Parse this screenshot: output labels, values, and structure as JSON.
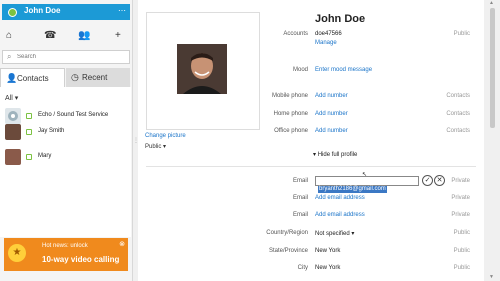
{
  "user": {
    "name": "John Doe"
  },
  "search": {
    "placeholder": "Search"
  },
  "tabs": [
    {
      "label": "Contacts"
    },
    {
      "label": "Recent"
    }
  ],
  "list_filter": "All",
  "contacts": [
    {
      "name": "Echo / Sound Test Service"
    },
    {
      "name": "Jay Smith"
    },
    {
      "name": "Mary"
    }
  ],
  "promo": {
    "line1": "Hot news: unlock",
    "line2": "10-way video calling"
  },
  "profile": {
    "display_name": "John Doe",
    "change_picture": "Change picture",
    "picture_visibility": "Public",
    "hide_full_profile": "Hide full profile",
    "fields": [
      {
        "label": "Accounts",
        "value": "doe47566",
        "sub": "Manage",
        "visibility": "Public"
      },
      {
        "label": "Mood",
        "value": "Enter mood message",
        "visibility": ""
      },
      {
        "label": "Mobile phone",
        "value": "Add number",
        "visibility": "Contacts"
      },
      {
        "label": "Home phone",
        "value": "Add number",
        "visibility": "Contacts"
      },
      {
        "label": "Office phone",
        "value": "Add number",
        "visibility": "Contacts"
      },
      {
        "label": "Email",
        "value": "bryanth2186@gmail.com",
        "visibility": "Private"
      },
      {
        "label": "Email",
        "value": "Add email address",
        "visibility": "Private"
      },
      {
        "label": "Email",
        "value": "Add email address",
        "visibility": "Private"
      },
      {
        "label": "Country/Region",
        "value": "Not specified",
        "visibility": "Public"
      },
      {
        "label": "State/Province",
        "value": "New York",
        "visibility": "Public"
      },
      {
        "label": "City",
        "value": "New York",
        "visibility": "Public"
      }
    ]
  },
  "colors": {
    "accent": "#1c9ad6",
    "link": "#1a74c9",
    "promo": "#f08a1d",
    "online": "#7cc242"
  },
  "icons": [
    "home-icon",
    "dial-icon",
    "contacts-icon",
    "add-contact-icon",
    "search-icon",
    "user-icon",
    "clock-icon"
  ]
}
